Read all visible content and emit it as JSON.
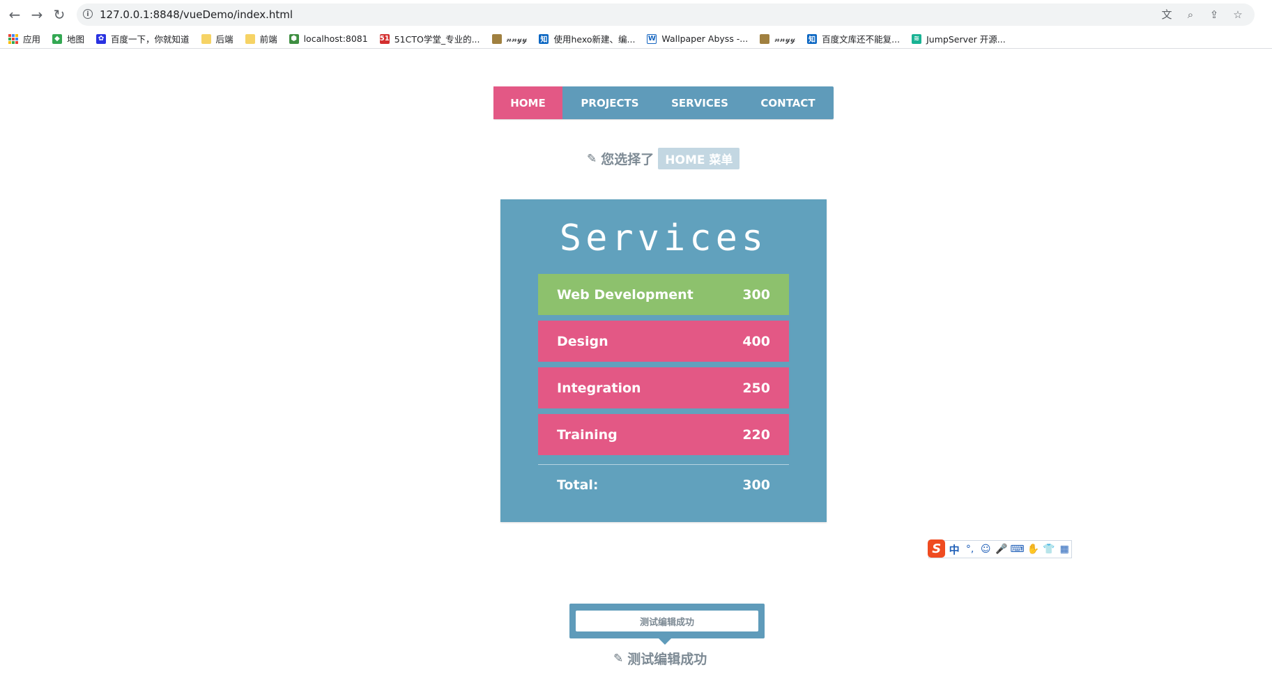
{
  "browser": {
    "url": "127.0.0.1:8848/vueDemo/index.html",
    "bookmarks": [
      {
        "label": "应用",
        "icon": "apps-grid-icon"
      },
      {
        "label": "地图",
        "icon": "maps-icon"
      },
      {
        "label": "百度一下，你就知道",
        "icon": "baidu-paw-icon"
      },
      {
        "label": "后端",
        "icon": "folder-icon"
      },
      {
        "label": "前端",
        "icon": "folder-icon"
      },
      {
        "label": "localhost:8081",
        "icon": "cube-icon"
      },
      {
        "label": "51CTO学堂_专业的...",
        "icon": "51cto-icon"
      },
      {
        "label": "𝓃𝓃𝓎𝓎",
        "icon": "avatar-icon"
      },
      {
        "label": "使用hexo新建、编...",
        "icon": "zhihu-icon"
      },
      {
        "label": "Wallpaper Abyss -...",
        "icon": "wallpaper-abyss-icon"
      },
      {
        "label": "𝓃𝓃𝓎𝓎",
        "icon": "avatar-icon"
      },
      {
        "label": "百度文库还不能复...",
        "icon": "zhihu-icon"
      },
      {
        "label": "JumpServer 开源...",
        "icon": "jumpserver-icon"
      }
    ]
  },
  "menu": {
    "items": [
      "HOME",
      "PROJECTS",
      "SERVICES",
      "CONTACT"
    ],
    "active": "HOME"
  },
  "selection": {
    "prefix": "您选择了",
    "badge": "HOME 菜单"
  },
  "services": {
    "title": "Services",
    "items": [
      {
        "name": "Web Development",
        "price": "300",
        "active": true
      },
      {
        "name": "Design",
        "price": "400",
        "active": false
      },
      {
        "name": "Integration",
        "price": "250",
        "active": false
      },
      {
        "name": "Training",
        "price": "220",
        "active": false
      }
    ],
    "total_label": "Total:",
    "total_value": "300"
  },
  "ime": {
    "logo": "S",
    "items": [
      "中",
      "°,",
      "☺",
      "🎤",
      "⌨",
      "✋",
      "👕",
      "▦"
    ]
  },
  "editor": {
    "input_value": "测试编辑成功",
    "display_text": "测试编辑成功"
  },
  "colors": {
    "menu_blue": "#5f9bba",
    "active_pink": "#e35885",
    "selected_green": "#8dc16d",
    "panel_blue": "#61a1bd"
  }
}
